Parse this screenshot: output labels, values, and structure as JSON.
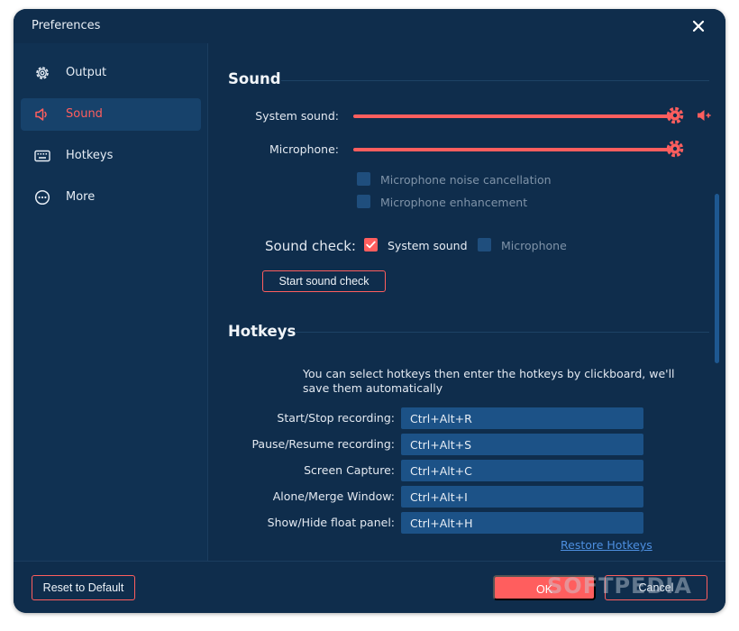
{
  "window": {
    "title": "Preferences"
  },
  "sidebar": {
    "items": [
      {
        "label": "Output",
        "icon": "gear-icon",
        "active": false
      },
      {
        "label": "Sound",
        "icon": "speaker-icon",
        "active": true
      },
      {
        "label": "Hotkeys",
        "icon": "keyboard-icon",
        "active": false
      },
      {
        "label": "More",
        "icon": "more-icon",
        "active": false
      }
    ]
  },
  "sound": {
    "title": "Sound",
    "system_sound_label": "System sound:",
    "system_sound_level": 1.0,
    "microphone_label": "Microphone:",
    "microphone_level": 1.0,
    "noise_cancellation_label": "Microphone noise cancellation",
    "noise_cancellation_checked": false,
    "enhancement_label": "Microphone enhancement",
    "enhancement_checked": false,
    "sound_check_label": "Sound check:",
    "check_system_label": "System sound",
    "check_system_checked": true,
    "check_mic_label": "Microphone",
    "check_mic_checked": false,
    "start_button_label": "Start sound check"
  },
  "hotkeys": {
    "title": "Hotkeys",
    "description": "You can select hotkeys then enter the hotkeys by clickboard, we'll save them automatically",
    "rows": [
      {
        "label": "Start/Stop recording:",
        "value": "Ctrl+Alt+R"
      },
      {
        "label": "Pause/Resume recording:",
        "value": "Ctrl+Alt+S"
      },
      {
        "label": "Screen Capture:",
        "value": "Ctrl+Alt+C"
      },
      {
        "label": "Alone/Merge Window:",
        "value": "Ctrl+Alt+I"
      },
      {
        "label": "Show/Hide float panel:",
        "value": "Ctrl+Alt+H"
      }
    ],
    "restore_label": "Restore Hotkeys"
  },
  "footer": {
    "reset_label": "Reset to Default",
    "ok_label": "OK",
    "cancel_label": "Cancel"
  },
  "watermark": "SOFTPEDIA",
  "colors": {
    "accent": "#ff5e5e",
    "background": "#0f2d4c",
    "field": "#1c5287",
    "link": "#4d8fe0"
  }
}
